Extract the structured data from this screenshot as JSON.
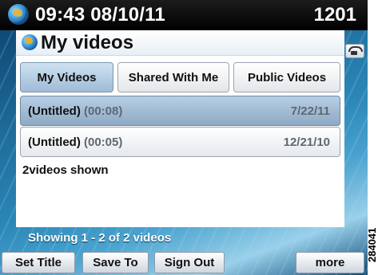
{
  "status_bar": {
    "time_date": "09:43 08/10/11",
    "extension": "1201"
  },
  "panel": {
    "title": "My videos",
    "tabs": [
      {
        "label": "My Videos",
        "selected": true
      },
      {
        "label": "Shared With Me",
        "selected": false
      },
      {
        "label": "Public Videos",
        "selected": false
      }
    ],
    "videos": [
      {
        "name": "(Untitled)",
        "duration": "(00:08)",
        "date": "7/22/11",
        "selected": true
      },
      {
        "name": "(Untitled)",
        "duration": "(00:05)",
        "date": "12/21/10",
        "selected": false
      }
    ],
    "count_text": "2videos shown"
  },
  "footer": {
    "status": "Showing 1 - 2 of 2 videos"
  },
  "softkeys": [
    "Set Title",
    "Save To",
    "Sign Out",
    "more"
  ],
  "figure_id": "284041",
  "icons": {
    "status_icon": "globe-icon",
    "title_icon": "globe-icon",
    "side_icon": "phone-icon"
  },
  "colors": {
    "selected_row": "#9fbbd6",
    "status_bar": "#000000",
    "background": "#2a86b6"
  }
}
